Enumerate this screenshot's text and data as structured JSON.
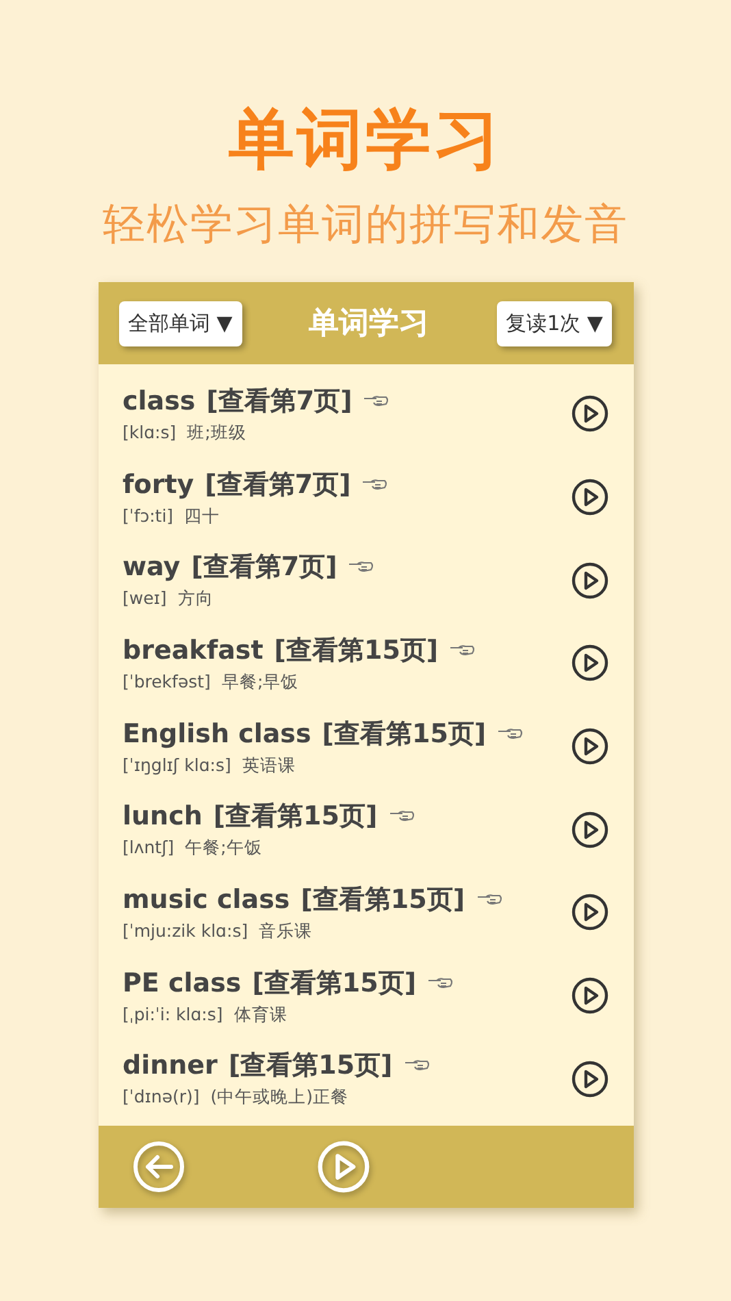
{
  "headline": "单词学习",
  "subtitle": "轻松学习单词的拼写和发音",
  "panel": {
    "title": "单词学习",
    "filter": "全部单词 ▼",
    "repeat": "复读1次 ▼"
  },
  "words": [
    {
      "word": "class",
      "page": "[查看第7页]",
      "phonetic": "[klɑ:s]",
      "meaning": "班;班级"
    },
    {
      "word": "forty",
      "page": "[查看第7页]",
      "phonetic": "[ˈfɔ:ti]",
      "meaning": "四十"
    },
    {
      "word": "way",
      "page": "[查看第7页]",
      "phonetic": "[weɪ]",
      "meaning": "方向"
    },
    {
      "word": "breakfast",
      "page": "[查看第15页]",
      "phonetic": "[ˈbrekfəst]",
      "meaning": "早餐;早饭"
    },
    {
      "word": "English class",
      "page": "[查看第15页]",
      "phonetic": "[ˈɪŋglɪʃ klɑ:s]",
      "meaning": "英语课"
    },
    {
      "word": "lunch",
      "page": "[查看第15页]",
      "phonetic": "[lʌntʃ]",
      "meaning": "午餐;午饭"
    },
    {
      "word": "music class",
      "page": "[查看第15页]",
      "phonetic": "[ˈmju:zik klɑ:s]",
      "meaning": "音乐课"
    },
    {
      "word": "PE class",
      "page": "[查看第15页]",
      "phonetic": "[ˌpi:ˈi: klɑ:s]",
      "meaning": "体育课"
    },
    {
      "word": "dinner",
      "page": "[查看第15页]",
      "phonetic": "[ˈdɪnə(r)]",
      "meaning": "(中午或晚上)正餐"
    }
  ]
}
